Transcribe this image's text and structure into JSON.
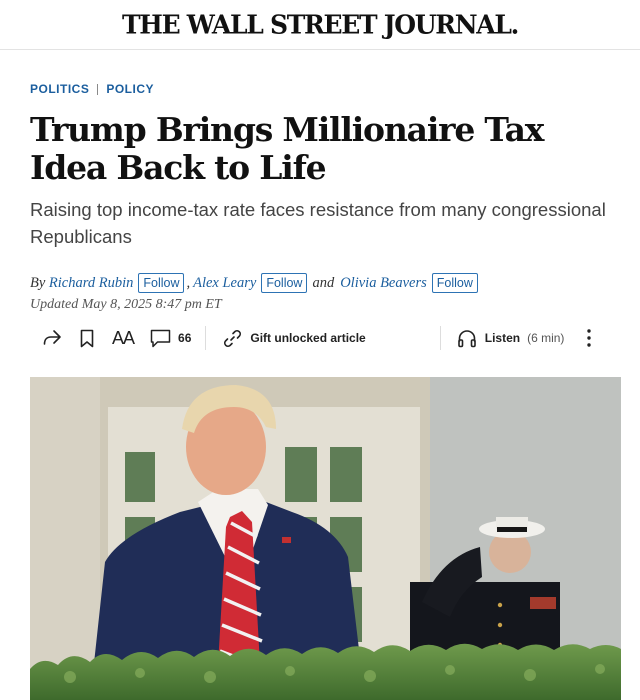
{
  "masthead": {
    "title": "THE WALL STREET JOURNAL."
  },
  "sections": [
    "POLITICS",
    "POLICY"
  ],
  "article": {
    "headline": "Trump Brings Millionaire Tax Idea Back to Life",
    "dek": "Raising top income-tax rate faces resistance from many congressional Republicans",
    "byline": {
      "by": "By",
      "authors": [
        "Richard Rubin",
        "Alex Leary",
        "Olivia Beavers"
      ],
      "follow_label": "Follow",
      "comma": ",",
      "and": "and"
    },
    "updated": "Updated May 8, 2025 8:47 pm ET"
  },
  "toolbar": {
    "text_size_label": "AA",
    "comment_count": "66",
    "gift_label": "Gift unlocked article",
    "listen_label": "Listen",
    "listen_duration": "(6 min)"
  },
  "icons": {
    "share": "share-icon",
    "bookmark": "bookmark-icon",
    "comment": "comment-icon",
    "gift": "link-icon",
    "listen": "headphones-icon",
    "more": "more-vertical-icon"
  },
  "colors": {
    "link": "#1b5e9e",
    "headline": "#111111",
    "dek": "#444444"
  }
}
